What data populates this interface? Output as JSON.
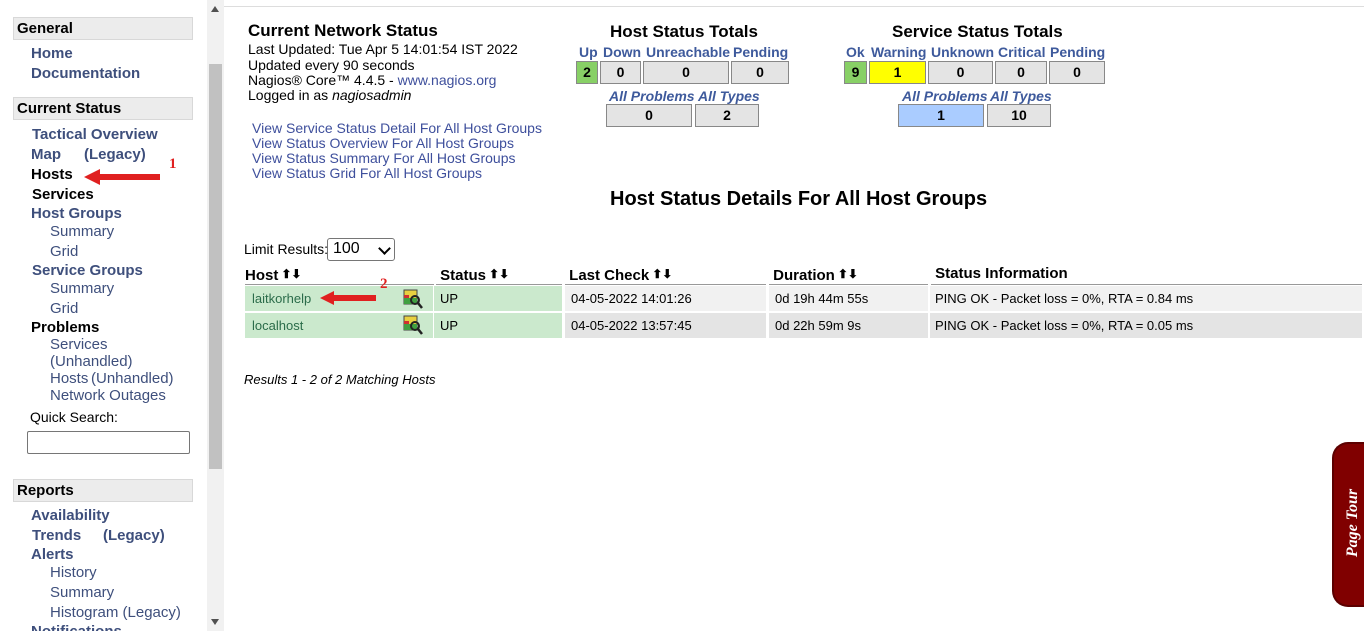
{
  "sidebar": {
    "general": {
      "header": "General",
      "home": "Home",
      "documentation": "Documentation"
    },
    "current_status": {
      "header": "Current Status",
      "tactical": "Tactical Overview",
      "map": "Map",
      "map_legacy": "(Legacy)",
      "hosts": "Hosts",
      "services": "Services",
      "host_groups": "Host Groups",
      "hg_summary": "Summary",
      "hg_grid": "Grid",
      "service_groups": "Service Groups",
      "sg_summary": "Summary",
      "sg_grid": "Grid",
      "problems": "Problems",
      "p_services": "Services",
      "p_unhandled": "(Unhandled)",
      "p_hosts": "Hosts",
      "p_hosts_unhandled": "(Unhandled)",
      "p_network_outages": "Network Outages",
      "quick_search_label": "Quick Search:",
      "quick_search_value": ""
    },
    "reports": {
      "header": "Reports",
      "availability": "Availability",
      "trends": "Trends",
      "trends_legacy": "(Legacy)",
      "alerts": "Alerts",
      "history": "History",
      "summary": "Summary",
      "histogram": "Histogram (Legacy)",
      "notifications": "Notifications"
    }
  },
  "annotations": {
    "one": "1",
    "two": "2"
  },
  "network_status": {
    "title": "Current Network Status",
    "last_updated": "Last Updated: Tue Apr 5 14:01:54 IST 2022",
    "updated_every": "Updated every 90 seconds",
    "core_prefix": "Nagios® Core™ 4.4.5 - ",
    "core_link": "www.nagios.org",
    "logged_prefix": "Logged in as ",
    "logged_user": "nagiosadmin"
  },
  "links": [
    "View Service Status Detail For All Host Groups",
    "View Status Overview For All Host Groups",
    "View Status Summary For All Host Groups",
    "View Status Grid For All Host Groups"
  ],
  "host_totals": {
    "title": "Host Status Totals",
    "headers": [
      "Up",
      "Down",
      "Unreachable",
      "Pending"
    ],
    "values": [
      "2",
      "0",
      "0",
      "0"
    ],
    "sub_headers": [
      "All Problems",
      "All Types"
    ],
    "sub_values": [
      "0",
      "2"
    ]
  },
  "service_totals": {
    "title": "Service Status Totals",
    "headers": [
      "Ok",
      "Warning",
      "Unknown",
      "Critical",
      "Pending"
    ],
    "values": [
      "9",
      "1",
      "0",
      "0",
      "0"
    ],
    "sub_headers": [
      "All Problems",
      "All Types"
    ],
    "sub_values": [
      "1",
      "10"
    ]
  },
  "details": {
    "title": "Host Status Details For All Host Groups",
    "limit_label": "Limit Results:",
    "limit_value": "100",
    "columns": [
      "Host",
      "Status",
      "Last Check",
      "Duration",
      "Status Information"
    ],
    "sort_glyph": "⬆⬇",
    "rows": [
      {
        "host": "laitkorhelp",
        "status": "UP",
        "last_check": "04-05-2022 14:01:26",
        "duration": "0d 19h 44m 55s",
        "info": "PING OK - Packet loss = 0%, RTA = 0.84 ms"
      },
      {
        "host": "localhost",
        "status": "UP",
        "last_check": "04-05-2022 13:57:45",
        "duration": "0d 22h 59m 9s",
        "info": "PING OK - Packet loss = 0%, RTA = 0.05 ms"
      }
    ],
    "results": "Results 1 - 2 of 2 Matching Hosts"
  },
  "page_tour": "Page Tour",
  "colors": {
    "up_green": "#88d066",
    "warning_yellow": "#ffff00",
    "problems_blue": "#aaccff",
    "row_green": "#cbe9cd",
    "annotation_red": "#e02020",
    "tour_maroon": "#800000"
  }
}
